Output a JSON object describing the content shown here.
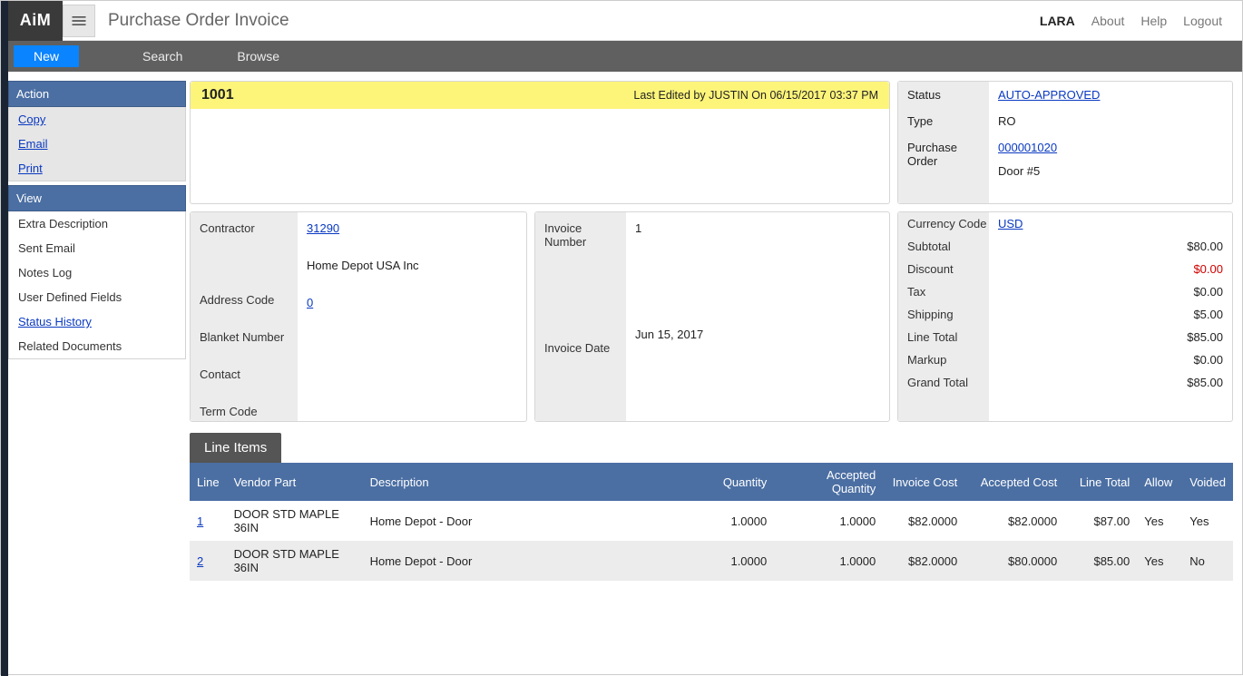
{
  "header": {
    "logo": "AiM",
    "title": "Purchase Order Invoice",
    "user": "LARA",
    "links": {
      "about": "About",
      "help": "Help",
      "logout": "Logout"
    }
  },
  "menubar": {
    "new": "New",
    "search": "Search",
    "browse": "Browse"
  },
  "sidebar": {
    "action_hdr": "Action",
    "actions": {
      "copy": "Copy",
      "email": "Email",
      "print": "Print"
    },
    "view_hdr": "View",
    "views": {
      "extra": "Extra Description",
      "sent": "Sent Email",
      "notes": "Notes Log",
      "udf": "User Defined Fields",
      "status_hist": "Status History",
      "related": "Related Documents"
    }
  },
  "record": {
    "number": "1001",
    "edited": "Last Edited by JUSTIN On 06/15/2017 03:37 PM"
  },
  "status_panel": {
    "labels": {
      "status": "Status",
      "type": "Type",
      "po": "Purchase Order"
    },
    "values": {
      "status": "AUTO-APPROVED",
      "type": "RO",
      "po": "000001020",
      "po_desc": "Door #5"
    }
  },
  "contractor_panel": {
    "labels": {
      "contractor": "Contractor",
      "address": "Address Code",
      "blanket": "Blanket Number",
      "contact": "Contact",
      "term": "Term Code"
    },
    "values": {
      "contractor": "31290",
      "contractor_name": "Home Depot USA Inc",
      "address": "0",
      "blanket": "",
      "contact": "",
      "term": ""
    }
  },
  "invoice_panel": {
    "labels": {
      "inv_no": "Invoice Number",
      "inv_date": "Invoice Date"
    },
    "values": {
      "inv_no": "1",
      "inv_date": "Jun 15, 2017"
    }
  },
  "currency_panel": {
    "labels": {
      "code": "Currency Code",
      "subtotal": "Subtotal",
      "discount": "Discount",
      "tax": "Tax",
      "shipping": "Shipping",
      "line_total": "Line Total",
      "markup": "Markup",
      "grand": "Grand Total"
    },
    "values": {
      "code": "USD",
      "subtotal": "$80.00",
      "discount": "$0.00",
      "tax": "$0.00",
      "shipping": "$5.00",
      "line_total": "$85.00",
      "markup": "$0.00",
      "grand": "$85.00"
    }
  },
  "line_items": {
    "title": "Line Items",
    "headers": {
      "line": "Line",
      "vendor": "Vendor Part",
      "desc": "Description",
      "qty": "Quantity",
      "acc_qty": "Accepted Quantity",
      "inv_cost": "Invoice Cost",
      "acc_cost": "Accepted Cost",
      "line_total": "Line Total",
      "allow": "Allow",
      "voided": "Voided"
    },
    "rows": [
      {
        "line": "1",
        "vendor": "DOOR STD MAPLE 36IN",
        "desc": "Home Depot - Door",
        "qty": "1.0000",
        "acc_qty": "1.0000",
        "inv_cost": "$82.0000",
        "acc_cost": "$82.0000",
        "line_total": "$87.00",
        "allow": "Yes",
        "voided": "Yes"
      },
      {
        "line": "2",
        "vendor": "DOOR STD MAPLE 36IN",
        "desc": "Home Depot - Door",
        "qty": "1.0000",
        "acc_qty": "1.0000",
        "inv_cost": "$82.0000",
        "acc_cost": "$80.0000",
        "line_total": "$85.00",
        "allow": "Yes",
        "voided": "No"
      }
    ]
  }
}
